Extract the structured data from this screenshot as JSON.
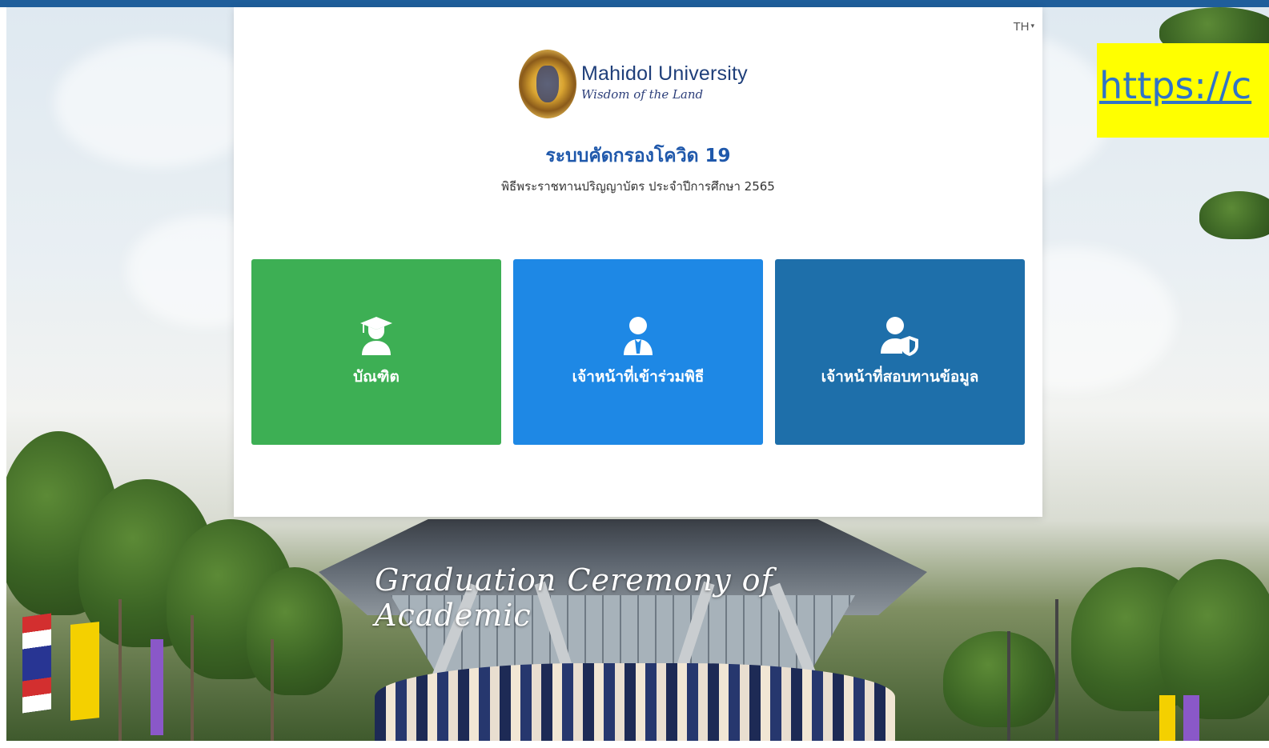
{
  "language_selector": {
    "label": "TH",
    "caret": "▾"
  },
  "logo": {
    "name": "Mahidol University",
    "tagline": "Wisdom of the Land"
  },
  "system_title": "ระบบคัดกรองโควิด 19",
  "subtitle": "พิธีพระราชทานปริญญาบัตร ประจำปีการศึกษา 2565",
  "tiles": [
    {
      "label": "บัณฑิต",
      "icon": "graduate-icon",
      "color": "#3daf54"
    },
    {
      "label": "เจ้าหน้าที่เข้าร่วมพิธี",
      "icon": "staff-icon",
      "color": "#1e88e5"
    },
    {
      "label": "เจ้าหน้าที่สอบทานข้อมูล",
      "icon": "user-shield-icon",
      "color": "#1e6faa"
    }
  ],
  "background": {
    "script_title": "Graduation Ceremony of Academic"
  },
  "overlay": {
    "url_text": "https://c",
    "highlight_color": "#ffff00"
  },
  "colors": {
    "top_bar": "#1f5e9b",
    "title": "#1f58ab"
  }
}
